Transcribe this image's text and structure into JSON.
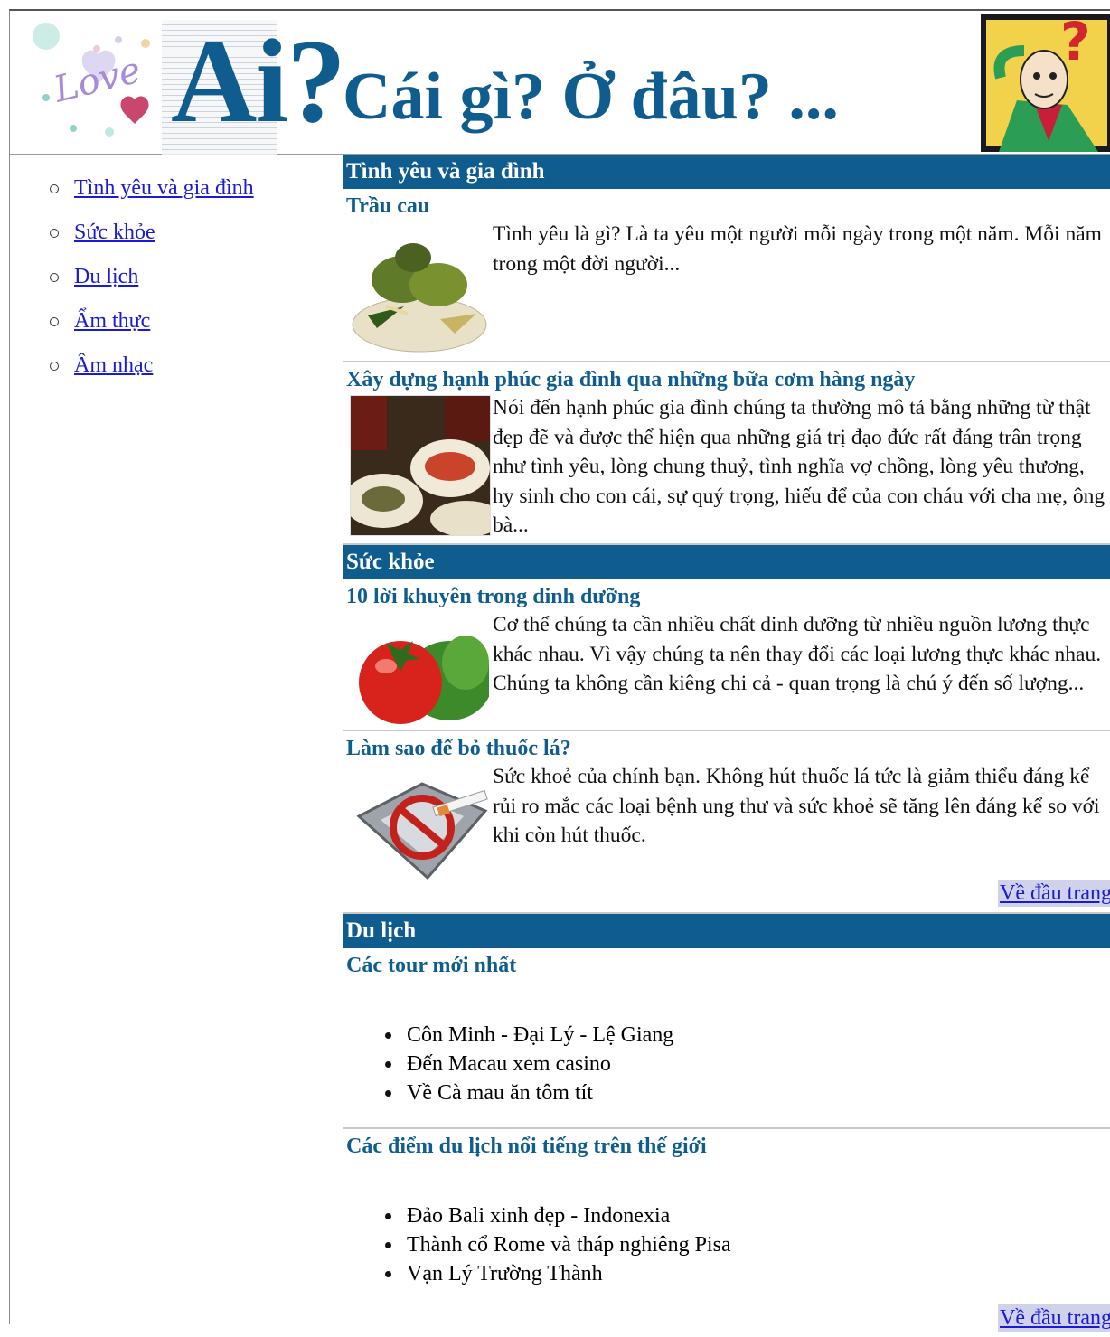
{
  "header": {
    "title_main": "Ai?",
    "title_rest": "Cái gì? Ở đâu? ..."
  },
  "sidebar": {
    "items": [
      {
        "label": "Tình yêu và gia đình"
      },
      {
        "label": "Sức khỏe"
      },
      {
        "label": "Du lịch"
      },
      {
        "label": "Ẩm thực"
      },
      {
        "label": "Âm nhạc"
      }
    ]
  },
  "sections": {
    "love": {
      "title": "Tình yêu và gia đình",
      "articles": [
        {
          "title": "Trầu cau",
          "text": "Tình yêu là gì? Là ta yêu một người mỗi ngày trong một năm. Mỗi năm trong một đời người...",
          "image_icon": "betel-areca-image"
        },
        {
          "title": "Xây dựng hạnh phúc gia đình qua những bữa cơm hàng ngày",
          "text": "Nói đến hạnh phúc gia đình chúng ta thường mô tả bằng những từ thật đẹp đẽ và được thể hiện qua những giá trị đạo đức rất đáng trân trọng như tình yêu, lòng chung thuỷ, tình nghĩa vợ chồng, lòng yêu thương, hy sinh cho con cái, sự quý trọng, hiếu để của con cháu với cha mẹ, ông bà...",
          "image_icon": "family-meal-image"
        }
      ]
    },
    "health": {
      "title": "Sức khỏe",
      "articles": [
        {
          "title": "10 lời khuyên trong dinh dưỡng",
          "text": "Cơ thể chúng ta cần nhiều chất dinh dưỡng từ nhiều nguồn lương thực khác nhau. Vì vậy chúng ta nên thay đổi các loại lương thực khác nhau. Chúng ta không cần kiêng chi cả - quan trọng là chú ý đến số lượng...",
          "image_icon": "tomato-image"
        },
        {
          "title": "Làm sao để bỏ thuốc lá?",
          "text": "Sức khoẻ của chính bạn. Không hút thuốc lá tức là giảm thiểu đáng kể rủi ro mắc các loại bệnh ung thư và sức khoẻ sẽ tăng lên đáng kể so với khi còn hút thuốc.",
          "image_icon": "no-smoking-image"
        }
      ],
      "top_link": "Về đầu trang"
    },
    "travel": {
      "title": "Du lịch",
      "blocks": [
        {
          "title": "Các tour mới nhất",
          "items": [
            "Côn Minh - Đại Lý - Lệ Giang",
            "Đến Macau xem casino",
            "Về Cà mau ăn tôm tít"
          ]
        },
        {
          "title": "Các điểm du lịch nổi tiếng trên thế giới",
          "items": [
            "Đảo Bali xinh đẹp - Indonexia",
            "Thành cổ Rome và tháp nghiêng Pisa",
            "Vạn Lý Trường Thành"
          ]
        }
      ],
      "top_link": "Về đầu trang"
    }
  },
  "colors": {
    "brand_blue": "#0f5c8e",
    "link": "#1b1bd6"
  }
}
